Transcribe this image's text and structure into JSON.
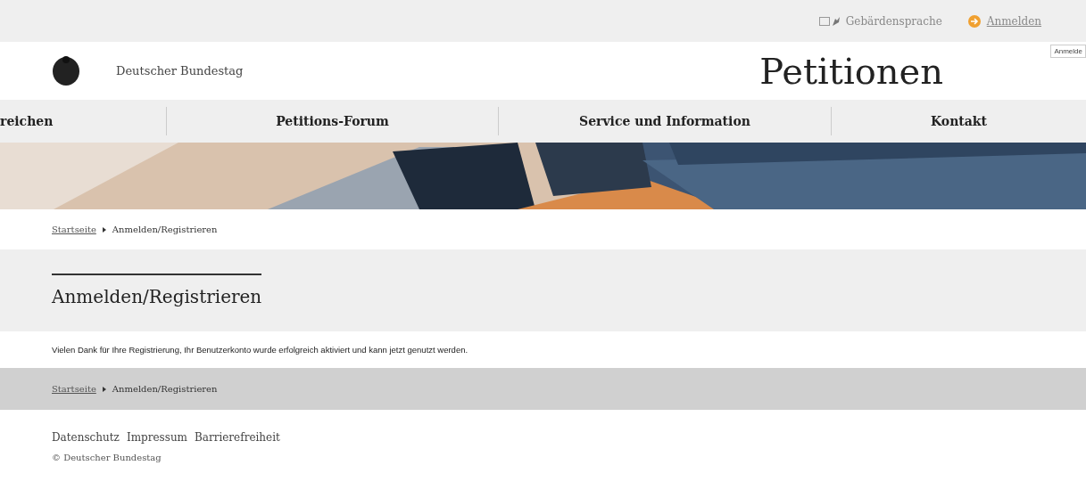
{
  "top_bar": {
    "sign_language": "Gebärdensprache",
    "login": "Anmelden",
    "tooltip": "Anmelde"
  },
  "header": {
    "org": "Deutscher Bundestag",
    "title": "Petitionen"
  },
  "nav": [
    {
      "label": "reichen",
      "selected": false
    },
    {
      "label": "Petitions-Forum",
      "selected": false
    },
    {
      "label": "Service und Information",
      "selected": false
    },
    {
      "label": "Kontakt",
      "selected": false
    }
  ],
  "breadcrumb": [
    {
      "label": "Startseite",
      "kind": "link"
    },
    {
      "label": "Anmelden/Registrieren",
      "kind": "current"
    }
  ],
  "page_title": "Anmelden/Registrieren",
  "message": "Vielen Dank für Ihre Registrierung, Ihr Benutzerkonto wurde erfolgreich aktiviert und kann jetzt genutzt werden.",
  "bottom_breadcrumb": [
    {
      "label": "Startseite",
      "kind": "link"
    },
    {
      "label": "Anmelden/Registrieren",
      "kind": "current"
    }
  ],
  "footer": {
    "links": [
      "Datenschutz",
      "Impressum",
      "Barrierefreiheit"
    ],
    "copyright": "© Deutscher Bundestag"
  }
}
